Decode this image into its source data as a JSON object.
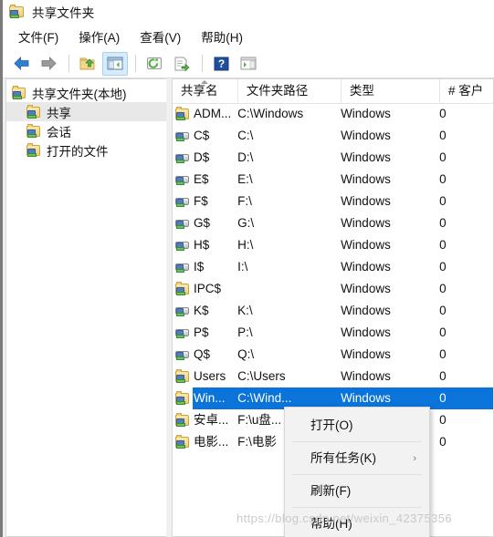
{
  "window": {
    "title": "共享文件夹",
    "title_icon": "shared-folder-icon"
  },
  "menubar": {
    "items": [
      {
        "label": "文件(F)"
      },
      {
        "label": "操作(A)"
      },
      {
        "label": "查看(V)"
      },
      {
        "label": "帮助(H)"
      }
    ]
  },
  "toolbar": {
    "buttons": [
      {
        "name": "back-icon",
        "glyph": "←"
      },
      {
        "name": "forward-icon",
        "glyph": "→"
      },
      {
        "name": "up-one-level-icon",
        "glyph": "↑"
      },
      {
        "name": "show-console-tree-icon",
        "glyph": "▤"
      },
      {
        "name": "refresh-icon",
        "glyph": "⟳"
      },
      {
        "name": "export-list-icon",
        "glyph": "▤"
      },
      {
        "name": "help-icon",
        "glyph": "?"
      },
      {
        "name": "show-action-pane-icon",
        "glyph": "▤"
      }
    ]
  },
  "sidebar": {
    "root": {
      "label": "共享文件夹(本地)",
      "icon": "shared-folder-icon"
    },
    "items": [
      {
        "label": "共享",
        "icon": "shared-folder-icon",
        "selected": true
      },
      {
        "label": "会话",
        "icon": "shared-folder-icon",
        "selected": false
      },
      {
        "label": "打开的文件",
        "icon": "shared-folder-icon",
        "selected": false
      }
    ]
  },
  "list": {
    "columns": [
      {
        "key": "name",
        "label": "共享名",
        "sorted": "asc"
      },
      {
        "key": "path",
        "label": "文件夹路径",
        "sorted": ""
      },
      {
        "key": "type",
        "label": "类型",
        "sorted": ""
      },
      {
        "key": "clients",
        "label": "# 客户",
        "sorted": ""
      }
    ],
    "rows": [
      {
        "icon": "shared-folder-icon",
        "name": "ADM...",
        "path": "C:\\Windows",
        "type": "Windows",
        "clients": "0",
        "selected": false
      },
      {
        "icon": "shared-drive-icon",
        "name": "C$",
        "path": "C:\\",
        "type": "Windows",
        "clients": "0",
        "selected": false
      },
      {
        "icon": "shared-drive-icon",
        "name": "D$",
        "path": "D:\\",
        "type": "Windows",
        "clients": "0",
        "selected": false
      },
      {
        "icon": "shared-drive-icon",
        "name": "E$",
        "path": "E:\\",
        "type": "Windows",
        "clients": "0",
        "selected": false
      },
      {
        "icon": "shared-drive-icon",
        "name": "F$",
        "path": "F:\\",
        "type": "Windows",
        "clients": "0",
        "selected": false
      },
      {
        "icon": "shared-drive-icon",
        "name": "G$",
        "path": "G:\\",
        "type": "Windows",
        "clients": "0",
        "selected": false
      },
      {
        "icon": "shared-drive-icon",
        "name": "H$",
        "path": "H:\\",
        "type": "Windows",
        "clients": "0",
        "selected": false
      },
      {
        "icon": "shared-drive-icon",
        "name": "I$",
        "path": "I:\\",
        "type": "Windows",
        "clients": "0",
        "selected": false
      },
      {
        "icon": "shared-folder-icon",
        "name": "IPC$",
        "path": "",
        "type": "Windows",
        "clients": "0",
        "selected": false
      },
      {
        "icon": "shared-drive-icon",
        "name": "K$",
        "path": "K:\\",
        "type": "Windows",
        "clients": "0",
        "selected": false
      },
      {
        "icon": "shared-drive-icon",
        "name": "P$",
        "path": "P:\\",
        "type": "Windows",
        "clients": "0",
        "selected": false
      },
      {
        "icon": "shared-drive-icon",
        "name": "Q$",
        "path": "Q:\\",
        "type": "Windows",
        "clients": "0",
        "selected": false
      },
      {
        "icon": "shared-folder-icon",
        "name": "Users",
        "path": "C:\\Users",
        "type": "Windows",
        "clients": "0",
        "selected": false
      },
      {
        "icon": "shared-folder-icon",
        "name": "Win...",
        "path": "C:\\Wind...",
        "type": "Windows",
        "clients": "0",
        "selected": true
      },
      {
        "icon": "shared-folder-icon",
        "name": "安卓...",
        "path": "F:\\u盘...",
        "type": "",
        "clients": "0",
        "selected": false
      },
      {
        "icon": "shared-folder-icon",
        "name": "电影...",
        "path": "F:\\电影",
        "type": "",
        "clients": "0",
        "selected": false
      }
    ]
  },
  "context_menu": {
    "items": [
      {
        "label": "打开(O)",
        "submenu": false
      },
      {
        "label": "所有任务(K)",
        "submenu": true
      },
      {
        "label": "刷新(F)",
        "submenu": false
      },
      {
        "label": "帮助(H)",
        "submenu": false
      }
    ],
    "submenu_arrow": "›"
  },
  "watermark": {
    "text": "https://blog.csdn.net/weixin_42375356"
  },
  "colors": {
    "selection_blue": "#0a74da",
    "toolbar_active": "#d6ebfb",
    "window_bg": "#f0f0f0"
  }
}
